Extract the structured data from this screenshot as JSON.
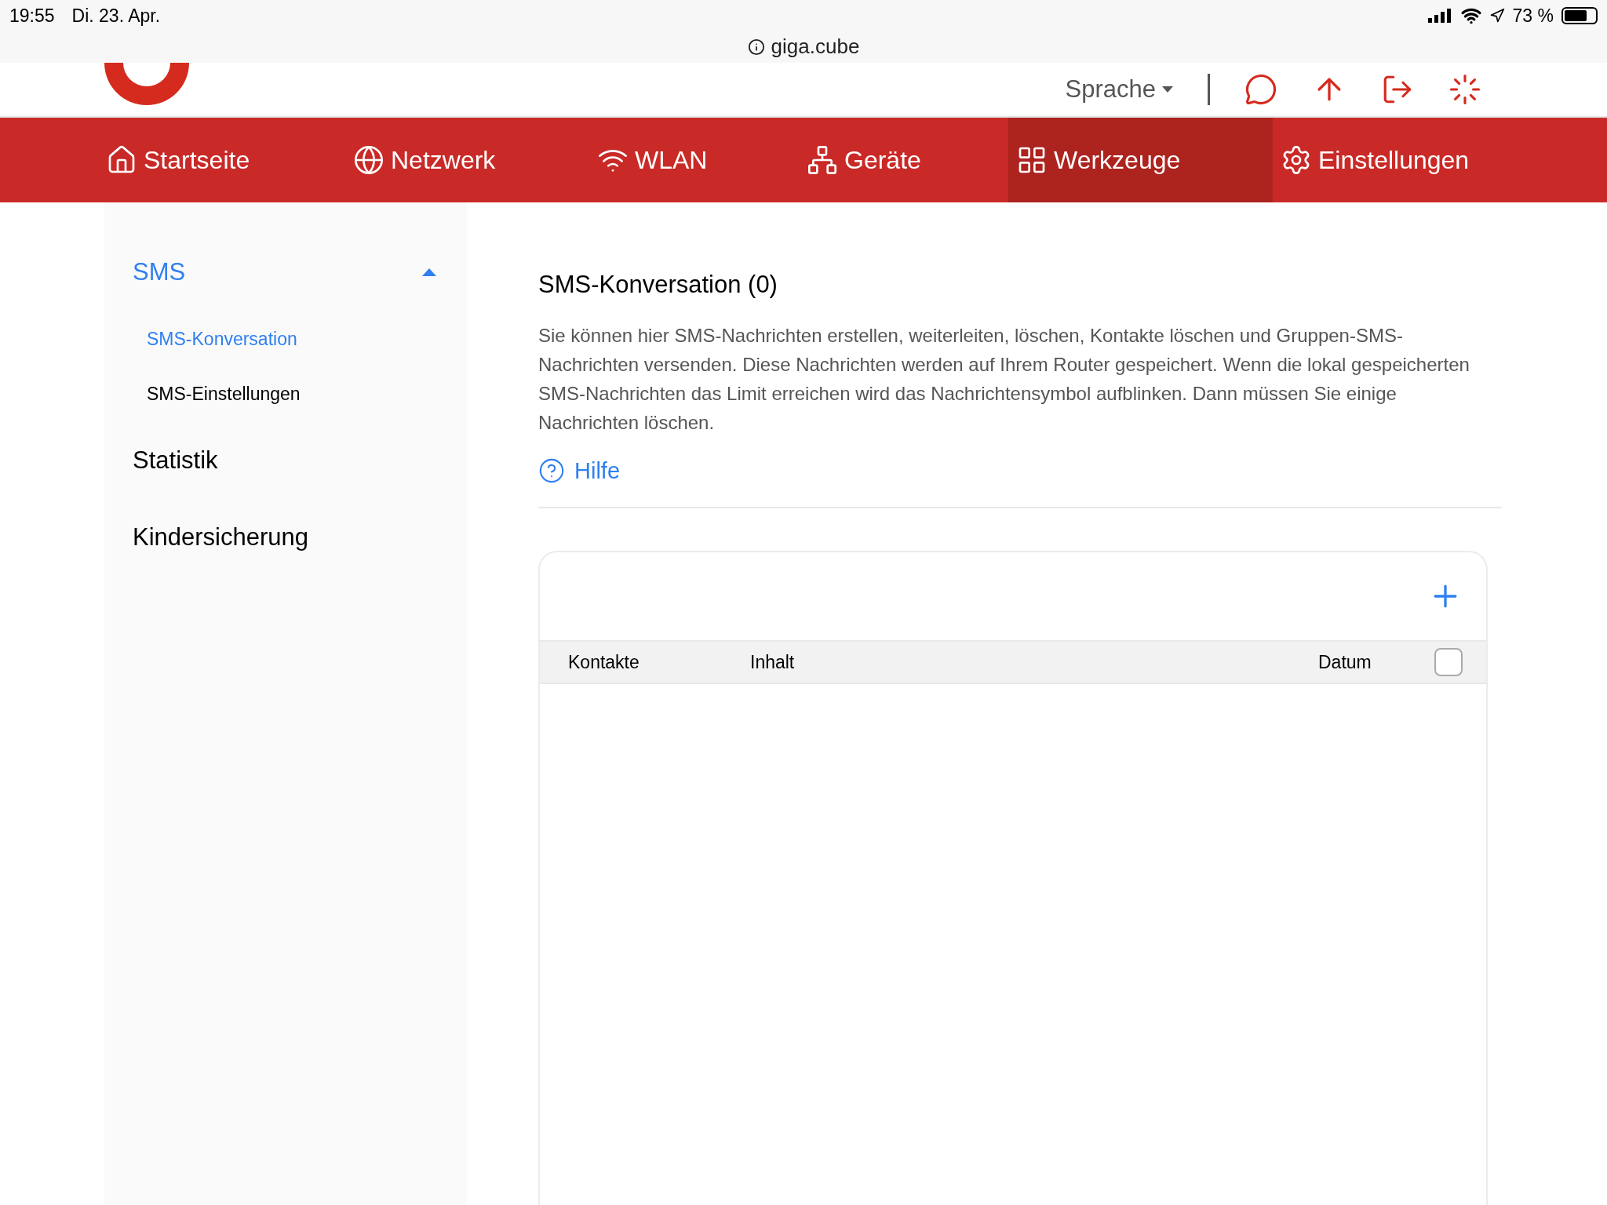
{
  "status_bar": {
    "time": "19:55",
    "date": "Di. 23. Apr.",
    "battery": "73 %",
    "level": 0.73
  },
  "address_bar": {
    "url": "giga.cube"
  },
  "header": {
    "language": "Sprache"
  },
  "nav": [
    {
      "label": "Startseite",
      "kind": "home",
      "selected": false
    },
    {
      "label": "Netzwerk",
      "kind": "network",
      "selected": false
    },
    {
      "label": "WLAN",
      "kind": "wlan",
      "selected": false
    },
    {
      "label": "Geräte",
      "kind": "devices",
      "selected": false
    },
    {
      "label": "Werkzeuge",
      "kind": "tools",
      "selected": true
    },
    {
      "label": "Einstellungen",
      "kind": "settings",
      "selected": false
    }
  ],
  "sidebar": {
    "items": [
      {
        "label": "SMS",
        "selected": true,
        "expanded": true,
        "children": [
          {
            "label": "SMS-Konversation",
            "selected": true
          },
          {
            "label": "SMS-Einstellungen",
            "selected": false
          }
        ]
      },
      {
        "label": "Statistik",
        "selected": false
      },
      {
        "label": "Kindersicherung",
        "selected": false
      }
    ]
  },
  "content": {
    "title": "SMS-Konversation (0)",
    "description": "Sie können hier SMS-Nachrichten erstellen, weiterleiten, löschen, Kontakte löschen und Gruppen-SMS-Nachrichten versenden. Diese Nachrichten werden auf Ihrem Router gespeichert. Wenn die lokal gespeicherten SMS-Nachrichten das Limit erreichen wird das Nachrichtensymbol aufblinken. Dann müssen Sie einige Nachrichten löschen.",
    "help": "Hilfe"
  },
  "table": {
    "columns": [
      "Kontakte",
      "Inhalt",
      "Datum"
    ],
    "select_all_checked": false
  }
}
